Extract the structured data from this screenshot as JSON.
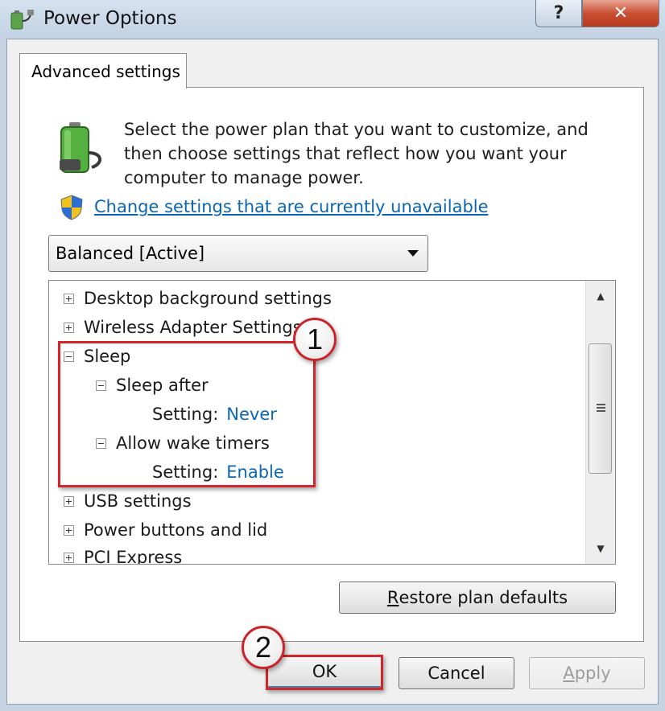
{
  "window": {
    "title": "Power Options",
    "app_icon": "power-options-icon",
    "help_label": "?",
    "close_label": "✕"
  },
  "tab": {
    "label": "Advanced settings"
  },
  "description": "Select the power plan that you want to customize, and then choose settings that reflect how you want your computer to manage power.",
  "change_link": "Change settings that are currently unavailable",
  "plan_select": {
    "value": "Balanced [Active]"
  },
  "tree": {
    "items": [
      {
        "label": "Desktop background settings",
        "expanded": false
      },
      {
        "label": "Wireless Adapter Settings",
        "expanded": false
      },
      {
        "label": "Sleep",
        "expanded": true
      },
      {
        "label": "Sleep after",
        "expanded": true
      },
      {
        "setting_label": "Setting:",
        "value": "Never"
      },
      {
        "label": "Allow wake timers",
        "expanded": true
      },
      {
        "setting_label": "Setting:",
        "value": "Enable"
      },
      {
        "label": "USB settings",
        "expanded": false
      },
      {
        "label": "Power buttons and lid",
        "expanded": false
      },
      {
        "label": "PCI Express",
        "expanded": false
      }
    ]
  },
  "buttons": {
    "restore_prefix": "R",
    "restore_rest": "estore plan defaults",
    "ok": "OK",
    "cancel": "Cancel",
    "apply_prefix": "A",
    "apply_rest": "pply"
  },
  "annotations": {
    "callout_1": "1",
    "callout_2": "2",
    "highlight_color": "#d4262a"
  }
}
